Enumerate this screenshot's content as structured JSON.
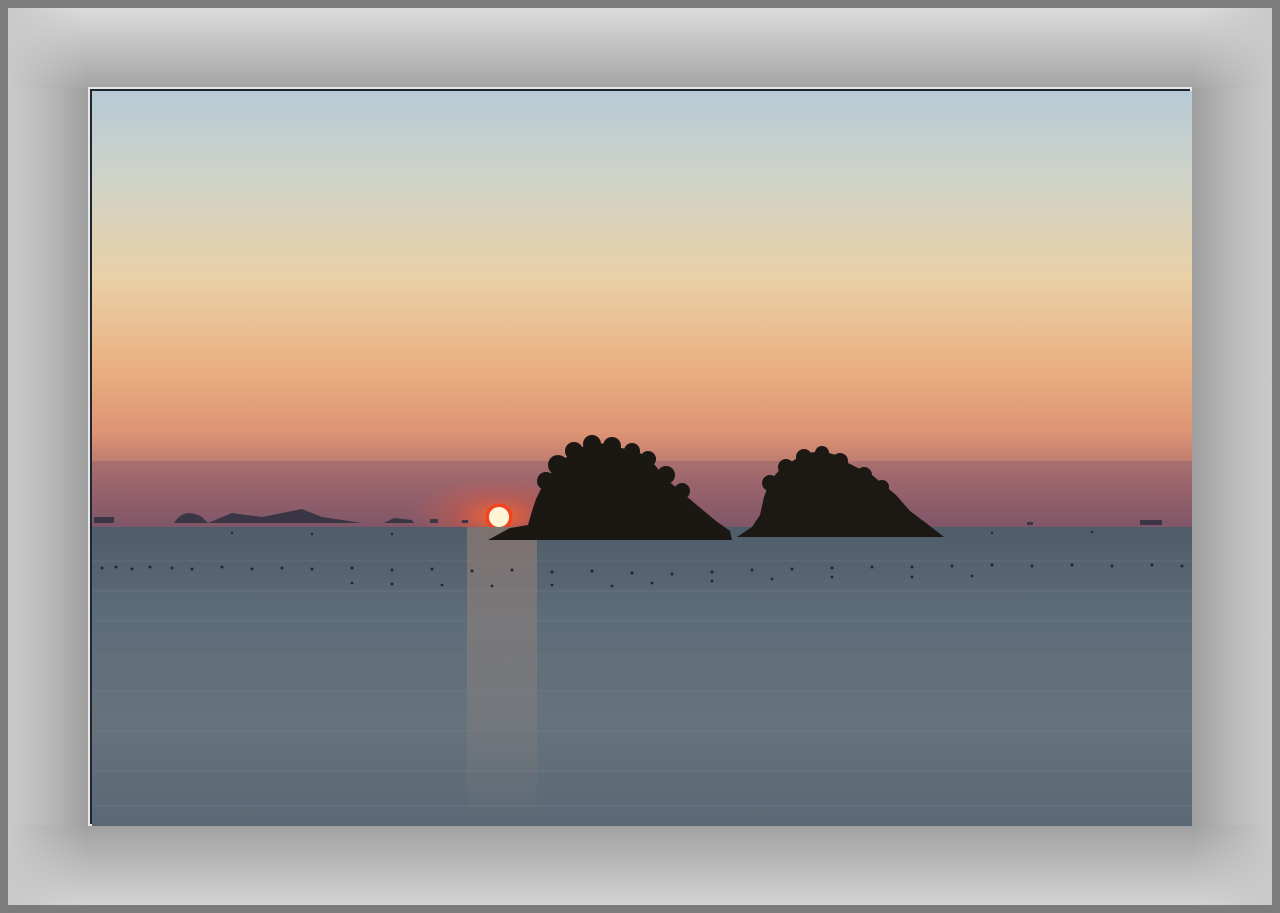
{
  "scene": {
    "type": "photograph",
    "subject": "sunset-over-sea",
    "colors": {
      "sky_top": "#b9cbd6",
      "sky_mid": "#e6cfa6",
      "sky_low": "#e89d6e",
      "sky_horizon": "#8e5862",
      "sun": "#ff4a1c",
      "sea": "#5a6a77",
      "island": "#1a1612",
      "mat": "#9b9b9b",
      "frame_line": "#e8e8e8"
    },
    "icons": [
      "sun-icon",
      "island-icon"
    ]
  }
}
